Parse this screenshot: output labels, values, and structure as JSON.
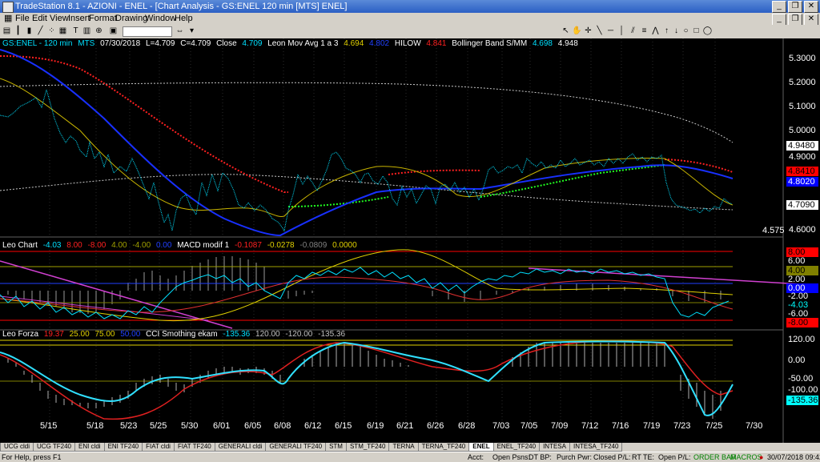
{
  "window": {
    "title": "TradeStation 8.1 - AZIONI - ENEL - [Chart Analysis - GS:ENEL  120 min  [MTS] ENEL]"
  },
  "menu": [
    "File",
    "Edit",
    "View",
    "Insert",
    "Format",
    "Drawing",
    "Window",
    "Help"
  ],
  "price_header": {
    "symbol": "GS:ENEL - 120 min",
    "mts": "MTS",
    "date": "07/30/2018",
    "last": "L=4.709",
    "close_eq": "C=4.709",
    "close_label": "Close",
    "close_val": "4.709",
    "ma_label": "Leon Mov Avg 1 a 3",
    "ma_val1": "4.694",
    "ma_val2": "4.802",
    "hilow_label": "HILOW",
    "hilow_val": "4.841",
    "bb_label": "Bollinger Band S/MM",
    "bb_val1": "4.698",
    "bb_val2": "4.948"
  },
  "price_axis": [
    "5.3000",
    "5.2000",
    "5.1000",
    "5.0000",
    "4.9000",
    "4.6000"
  ],
  "price_tags": [
    {
      "text": "4.9480",
      "bg": "#ffffff",
      "fg": "#000000"
    },
    {
      "text": "4.8410",
      "bg": "#ff0000",
      "fg": "#000000"
    },
    {
      "text": "4.8020",
      "bg": "#0000ff",
      "fg": "#ffffff"
    },
    {
      "text": "4.7090",
      "bg": "#ffffff",
      "fg": "#000000"
    }
  ],
  "low_label": "4.575",
  "leo_header": {
    "name": "Leo Chart",
    "v1": "-4.03",
    "v2": "8.00",
    "v3": "-8.00",
    "v4": "4.00",
    "v5": "-4.00",
    "v6": "0.00",
    "macd_label": "MACD modif 1",
    "m1": "-0.1087",
    "m2": "-0.0278",
    "m3": "-0.0809",
    "m4": "0.0000"
  },
  "leo_axis": [
    {
      "text": "8.00",
      "bg": "#ff0000",
      "fg": "#000000"
    },
    {
      "text": "6.00",
      "bg": "",
      "fg": "#ffffff"
    },
    {
      "text": "4.00",
      "bg": "#808000",
      "fg": "#000000"
    },
    {
      "text": "2.00",
      "bg": "",
      "fg": "#ffffff"
    },
    {
      "text": "0.00",
      "bg": "#0000ff",
      "fg": "#ffffff"
    },
    {
      "text": "-2.00",
      "bg": "",
      "fg": "#ffffff"
    },
    {
      "text": "-4.03",
      "bg": "",
      "fg": "#00ffff"
    },
    {
      "text": "-6.00",
      "bg": "",
      "fg": "#ffffff"
    },
    {
      "text": "-8.00",
      "bg": "#ff0000",
      "fg": "#000000"
    }
  ],
  "forza_header": {
    "name": "Leo Forza",
    "v1": "19.37",
    "v2": "25.00",
    "v3": "75.00",
    "v4": "50.00",
    "cci_label": "CCI Smothing ekam",
    "c1": "-135.36",
    "c2": "120.00",
    "c3": "-120.00",
    "c4": "-135.36"
  },
  "forza_axis": [
    {
      "text": "120.00",
      "bg": "",
      "fg": "#ffffff"
    },
    {
      "text": "0.00",
      "bg": "",
      "fg": "#ffffff"
    },
    {
      "text": "-50.00",
      "bg": "",
      "fg": "#ffffff"
    },
    {
      "text": "-100.00",
      "bg": "",
      "fg": "#ffffff"
    },
    {
      "text": "-135.36",
      "bg": "#00ffff",
      "fg": "#000000"
    }
  ],
  "x_axis": [
    "5/15",
    "5/18",
    "5/23",
    "5/25",
    "5/30",
    "6/01",
    "6/05",
    "6/08",
    "6/12",
    "6/15",
    "6/19",
    "6/21",
    "6/26",
    "6/28",
    "7/03",
    "7/05",
    "7/09",
    "7/12",
    "7/16",
    "7/19",
    "7/23",
    "7/25",
    "7/30"
  ],
  "tabs": [
    "UCG cldi",
    "UCG TF240",
    "ENI cldi",
    "ENI TF240",
    "FIAT cldi",
    "FIAT TF240",
    "GENERALI cldi",
    "GENERALI TF240",
    "STM",
    "STM_TF240",
    "TERNA",
    "TERNA_TF240",
    "ENEL",
    "ENEL_TF240",
    "INTESA",
    "INTESA_TF240"
  ],
  "active_tab": "ENEL",
  "status": {
    "help": "For Help, press F1",
    "acct": "Acct:",
    "open_psns": "Open Psns:",
    "dt_bp": "DT BP:",
    "purch_pwr": "Purch Pwr:",
    "closed_pl": "Closed P/L:",
    "rt_te": "RT TE:",
    "open_pl": "Open P/L:",
    "order_bar": "ORDER BAR",
    "macros": "MACROS",
    "datetime": "30/07/2018 09:42"
  }
}
